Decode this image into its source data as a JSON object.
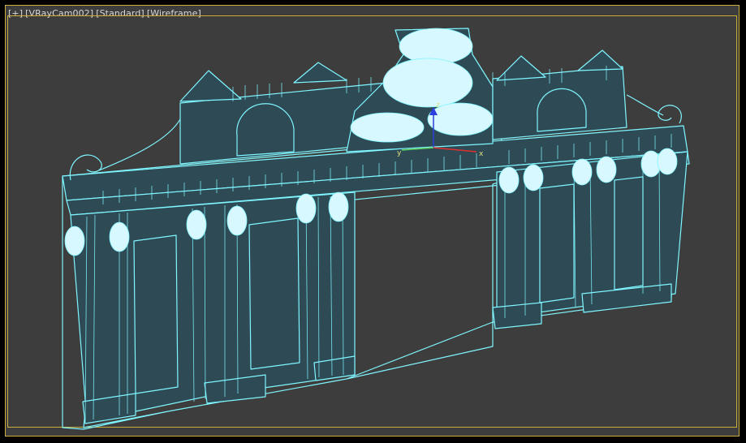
{
  "viewport": {
    "labels": {
      "plus": "[+]",
      "camera": "[VRayCam002]",
      "shading": "[Standard]",
      "mode": "[Wireframe]"
    },
    "colors": {
      "background": "#3d3d3d",
      "frame": "#c9ae3c",
      "wire": "#7ff6ff",
      "wire_fill": "#2e4a55",
      "gizmo_x": "#e03030",
      "gizmo_y": "#5fd35f",
      "gizmo_z": "#2b3fe0"
    },
    "gizmo": {
      "x_label": "x",
      "y_label": "y",
      "z_label": "z"
    }
  }
}
